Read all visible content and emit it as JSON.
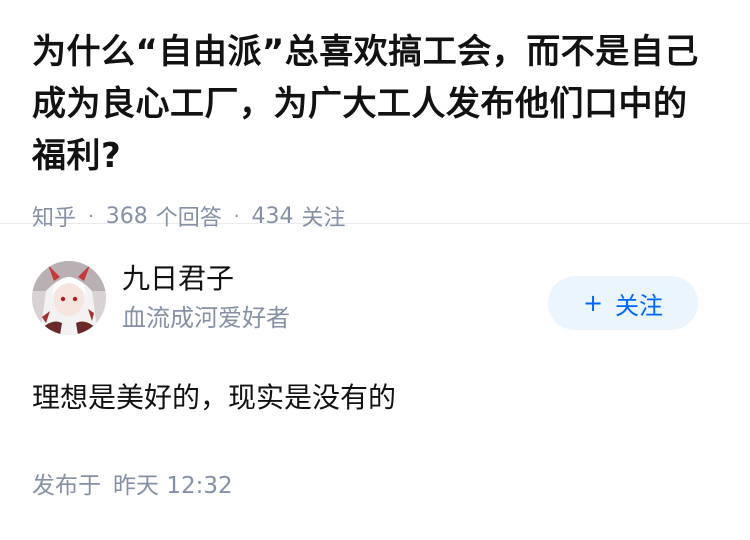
{
  "question": {
    "title": "为什么“自由派”总喜欢搞工会，而不是自己成为良心工厂，为广大工人发布他们口中的福利?",
    "source": "知乎",
    "separator": "·",
    "answer_count": "368",
    "answer_label": "个回答",
    "follower_count": "434",
    "follower_label": "关注"
  },
  "answer": {
    "author": {
      "name": "九日君子",
      "bio": "血流成河爱好者",
      "avatar_icon": "anime-avatar-icon"
    },
    "follow_button": {
      "plus": "+",
      "label": "关注"
    },
    "content": "理想是美好的，现实是没有的",
    "time_prefix": "发布于",
    "time_day": "昨天",
    "time_clock": "12:32"
  },
  "colors": {
    "text_primary": "#121212",
    "text_secondary": "#8590a6",
    "accent": "#0066ff",
    "follow_bg": "#ebf5fd",
    "divider": "#ebebeb"
  }
}
